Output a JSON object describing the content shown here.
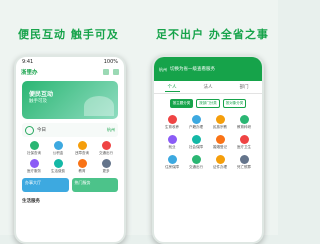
{
  "captions": {
    "left": "便民互动  触手可及",
    "right": "足不出户  办全省之事"
  },
  "left_phone": {
    "status_time": "9:41",
    "status_right": "100%",
    "header_title": "浙里办",
    "banner_title": "便民互动",
    "banner_subtitle": "触手可及",
    "weather_label": "今日",
    "weather_right": "杭州",
    "grid": [
      {
        "label": "社保查询",
        "color": "#2bb673"
      },
      {
        "label": "公积金",
        "color": "#3da9e0"
      },
      {
        "label": "违章查询",
        "color": "#f59e0b"
      },
      {
        "label": "交通出行",
        "color": "#ef4444"
      },
      {
        "label": "医疗服务",
        "color": "#8b5cf6"
      },
      {
        "label": "生活缴费",
        "color": "#14b8a6"
      },
      {
        "label": "教育",
        "color": "#f97316"
      },
      {
        "label": "更多",
        "color": "#64748b"
      }
    ],
    "cards": [
      "办事大厅",
      "热门服务"
    ],
    "section": "生活服务"
  },
  "right_phone": {
    "loc": "杭州",
    "header_title": "切换为省一级查看服务",
    "tabs": [
      "个人",
      "法人",
      "部门",
      ""
    ],
    "active_tab": 0,
    "chips": [
      "按主题分类",
      "按部门分类",
      "按对象分类"
    ],
    "grid": [
      {
        "label": "生育收养",
        "color": "#ef4444"
      },
      {
        "label": "户籍办理",
        "color": "#3da9e0"
      },
      {
        "label": "民族宗教",
        "color": "#f59e0b"
      },
      {
        "label": "教育科研",
        "color": "#2bb673"
      },
      {
        "label": "就业",
        "color": "#8b5cf6"
      },
      {
        "label": "社会保障",
        "color": "#14b8a6"
      },
      {
        "label": "婚姻登记",
        "color": "#f97316"
      },
      {
        "label": "医疗卫生",
        "color": "#ef4444"
      },
      {
        "label": "住房保障",
        "color": "#3da9e0"
      },
      {
        "label": "交通出行",
        "color": "#2bb673"
      },
      {
        "label": "证件办理",
        "color": "#f59e0b"
      },
      {
        "label": "死亡殡葬",
        "color": "#64748b"
      }
    ]
  }
}
